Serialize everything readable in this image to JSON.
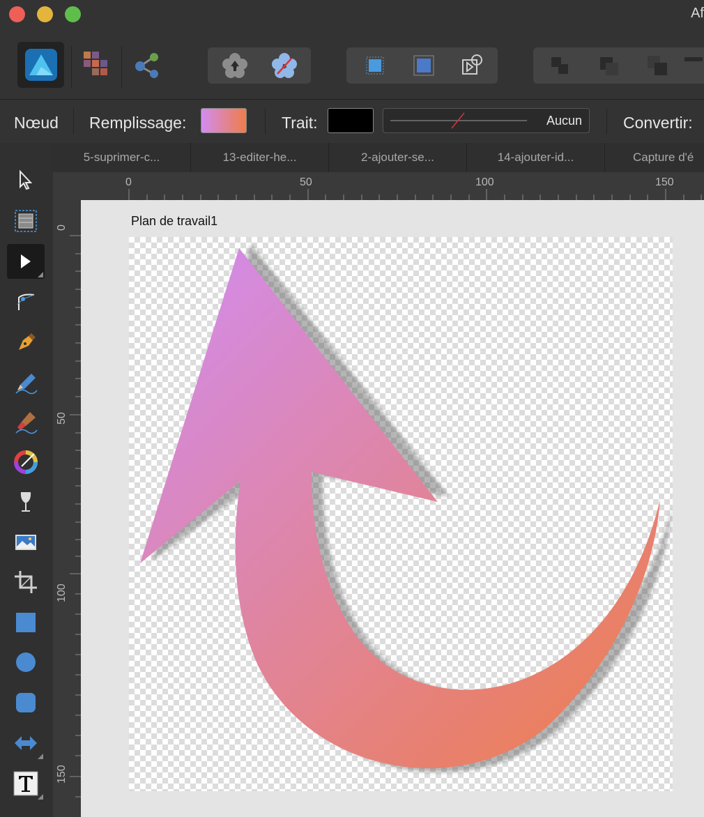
{
  "window": {
    "app_title": "Af"
  },
  "context_bar": {
    "tool_name": "Nœud",
    "fill_label": "Remplissage:",
    "stroke_label": "Trait:",
    "stroke_style_value": "Aucun",
    "convert_label": "Convertir:"
  },
  "tabs": [
    "5-suprimer-c...",
    "13-editer-he...",
    "2-ajouter-se...",
    "14-ajouter-id...",
    "Capture d'é"
  ],
  "rulers": {
    "unit": "px",
    "h_ticks": [
      "0",
      "50",
      "100",
      "150"
    ],
    "v_ticks": [
      "0",
      "50",
      "100",
      "150"
    ]
  },
  "artboard": {
    "name": "Plan de travail1"
  },
  "colors": {
    "gradient_start": "#d18cf2",
    "gradient_end": "#ef7d48",
    "stroke": "#000000"
  }
}
